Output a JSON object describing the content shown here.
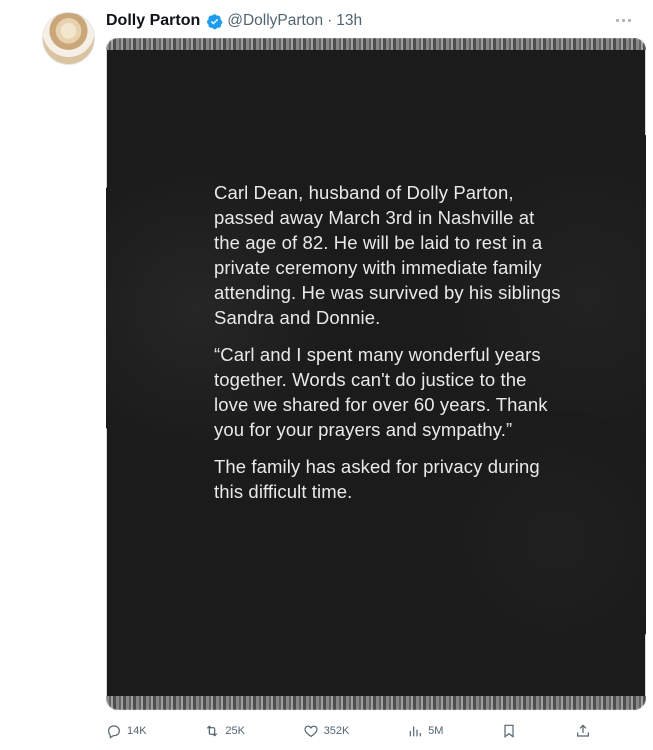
{
  "author": {
    "display_name": "Dolly Parton",
    "handle": "@DollyParton",
    "separator": "·",
    "time": "13h"
  },
  "post_image": {
    "paragraphs": [
      "Carl Dean, husband of Dolly Parton, passed away March 3rd in Nashville at the age of 82. He will be laid to rest in a private ceremony with immediate family attending. He was survived by his siblings Sandra and Donnie.",
      "“Carl and I spent many wonderful years together. Words can't do justice to the love we shared for over 60 years. Thank you for your prayers and sympathy.”",
      "The family has asked for privacy during this difficult time."
    ]
  },
  "actions": {
    "replies": "14K",
    "reposts": "25K",
    "likes": "352K",
    "views": "5M"
  },
  "icons": {
    "verified": "verified-badge-icon",
    "more": "more-icon",
    "reply": "reply-icon",
    "repost": "repost-icon",
    "like": "heart-icon",
    "views": "views-icon",
    "bookmark": "bookmark-icon",
    "share": "share-icon"
  },
  "colors": {
    "verified_blue": "#1d9bf0",
    "muted_text": "#536471",
    "image_background": "#1b1b1b",
    "image_text": "#e9e9e9"
  }
}
